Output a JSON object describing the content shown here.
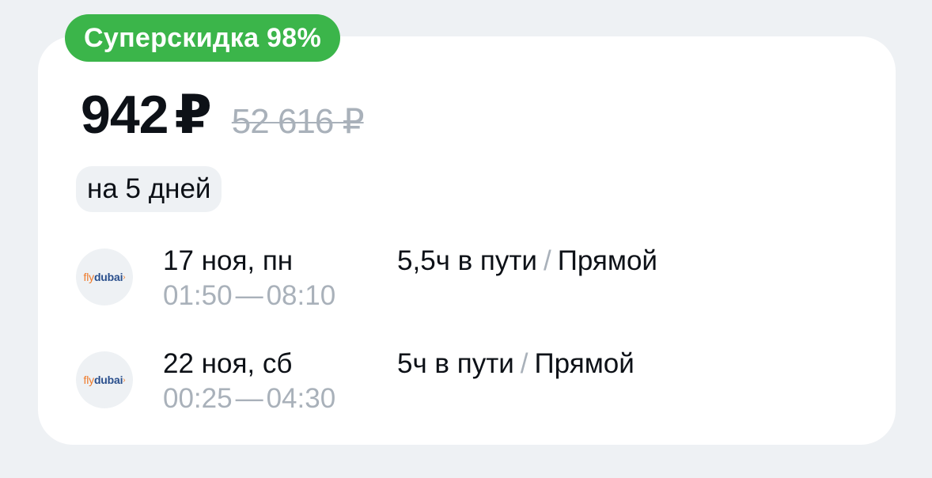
{
  "badge": {
    "label": "Суперскидка 98%"
  },
  "price": {
    "current": "942",
    "currency": "₽",
    "old": "52 616 ₽"
  },
  "duration_chip": "на 5 дней",
  "flights": [
    {
      "airline": {
        "fly": "fly",
        "dubai": "dubai"
      },
      "date": "17 ноя, пн",
      "departure": "01:50",
      "arrival": "08:10",
      "travel_time": "5,5ч в пути",
      "stops": "Прямой"
    },
    {
      "airline": {
        "fly": "fly",
        "dubai": "dubai"
      },
      "date": "22 ноя, сб",
      "departure": "00:25",
      "arrival": "04:30",
      "travel_time": "5ч в пути",
      "stops": "Прямой"
    }
  ],
  "colors": {
    "badge": "#3bb54a",
    "text_primary": "#0d1117",
    "text_muted": "#a9b1ba",
    "background": "#eef1f4",
    "brand_orange": "#ef7b2b",
    "brand_blue": "#2a4f8c"
  }
}
